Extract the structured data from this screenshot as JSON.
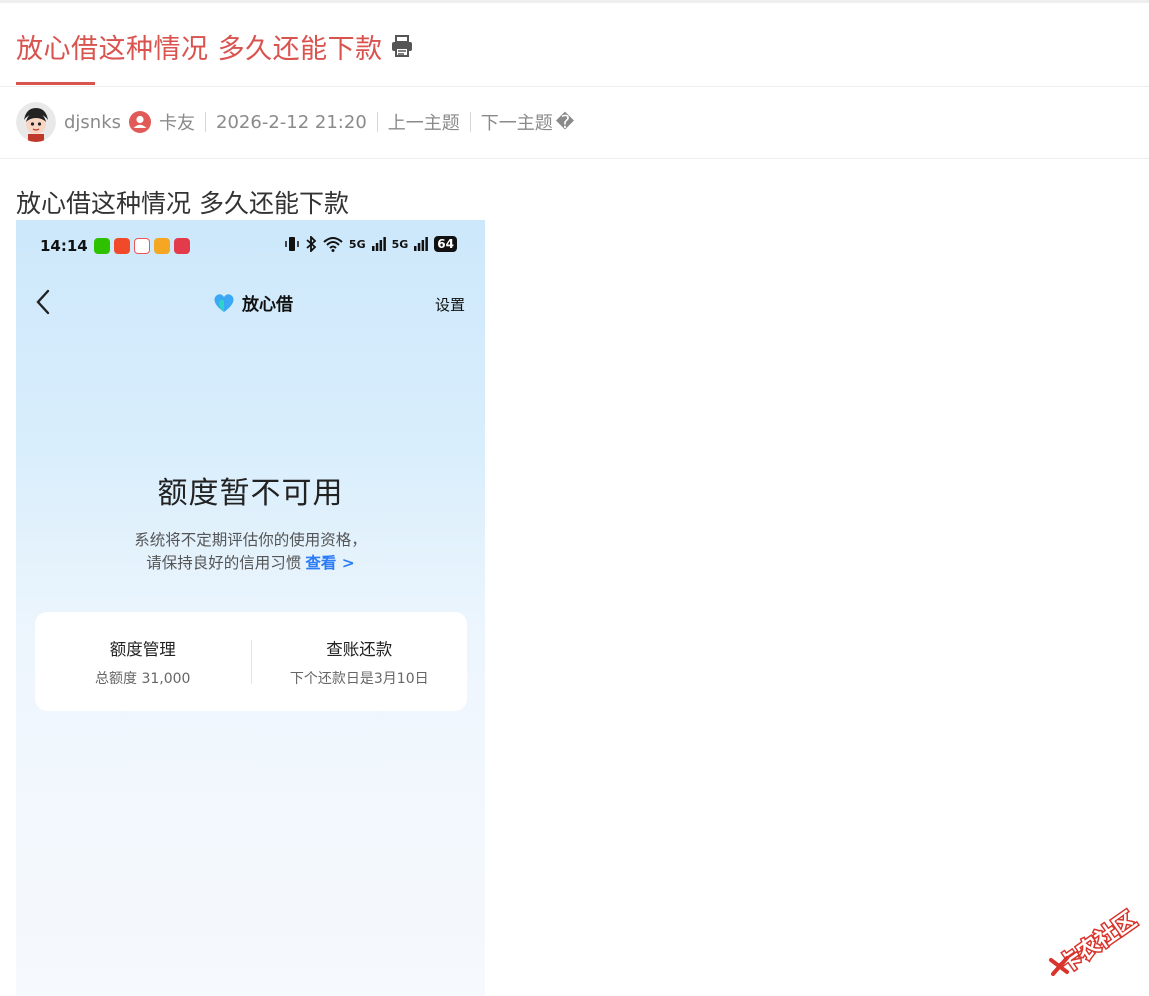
{
  "post": {
    "title": "放心借这种情况 多久还能下款",
    "body": "放心借这种情况 多久还能下款"
  },
  "meta": {
    "author": "djsnks",
    "role": "卡友",
    "datetime": "2026-2-12 21:20",
    "prev_topic": "上一主题",
    "next_topic": "下一主题",
    "next_suffix": "�"
  },
  "phone": {
    "status_time": "14:14",
    "battery": "64",
    "signal_1": "5G",
    "signal_2": "5G",
    "nav_title": "放心借",
    "nav_settings": "设置",
    "headline": "额度暂不可用",
    "desc_line1": "系统将不定期评估你的使用资格，",
    "desc_line2": "请保持良好的信用习惯",
    "view_link": "查看 >",
    "card": {
      "left_title": "额度管理",
      "left_sub": "总额度 31,000",
      "right_title": "查账还款",
      "right_sub": "下个还款日是3月10日"
    }
  },
  "watermark_text": "卡农社区",
  "colors": {
    "accent_red": "#d9534f",
    "link_blue": "#2b7cf5"
  },
  "icons": {
    "print": "print-icon",
    "user_badge": "user-circle-icon",
    "back": "chevron-left-icon",
    "logo": "heart-logo-icon"
  }
}
